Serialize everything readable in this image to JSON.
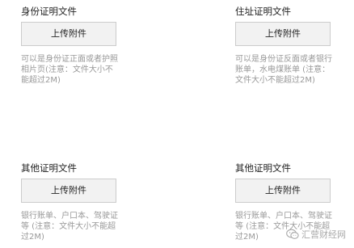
{
  "sections": [
    {
      "title": "身份证明文件",
      "button_label": "上传附件",
      "hint": "可以是身份证正面或者护照相片页(注意：文件大小不能超过2M)"
    },
    {
      "title": "住址证明文件",
      "button_label": "上传附件",
      "hint": "可以是身份证反面或者银行账单，水电煤账单 (注意：文件大小不能超过2M)"
    },
    {
      "title": "其他证明文件",
      "button_label": "上传附件",
      "hint": "银行账单、户口本、驾驶证等 (注意：文件大小不能超过2M)"
    },
    {
      "title": "其他证明文件",
      "button_label": "上传附件",
      "hint": "银行账单、户口本、驾驶证等 (注意：文件大小不能超过2M)"
    }
  ],
  "watermark": {
    "text": "汇营财经网",
    "icon": "wechat-bubble-icon"
  }
}
